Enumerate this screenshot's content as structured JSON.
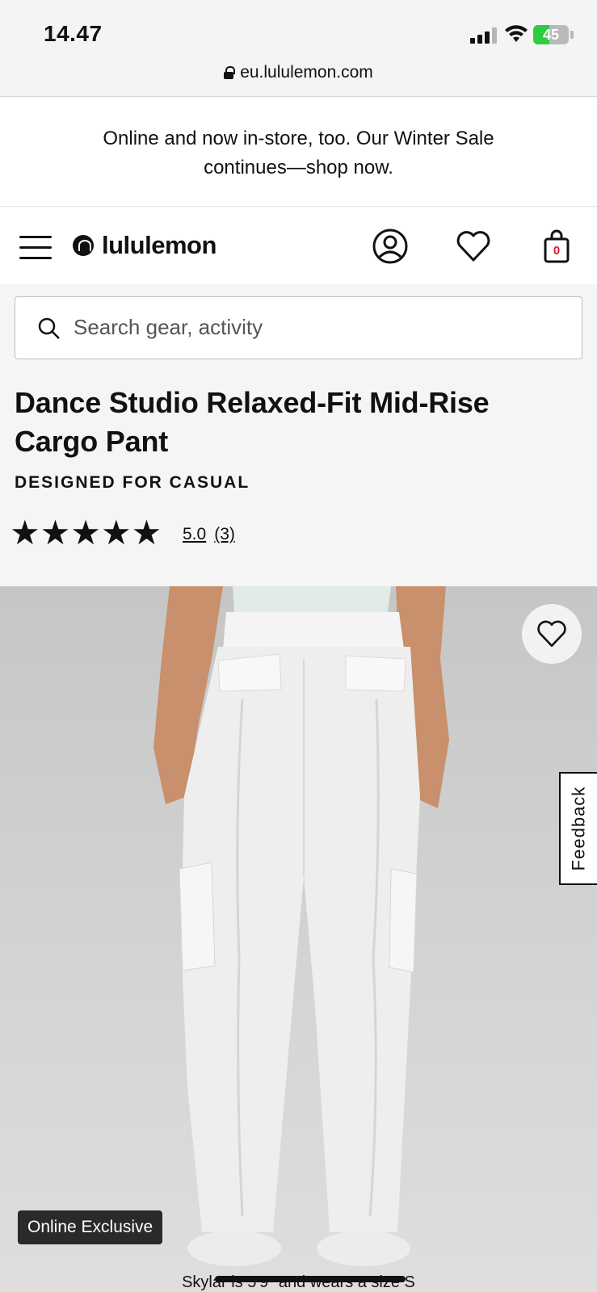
{
  "status_bar": {
    "time": "14.47",
    "battery": "45",
    "battery_fraction": 0.45
  },
  "browser": {
    "url": "eu.lululemon.com"
  },
  "promo": {
    "line1": "Online and now in-store, too. Our Winter Sale",
    "line2": "continues—shop now."
  },
  "header": {
    "logo_text": "lululemon",
    "icons": [
      "menu-icon",
      "account-icon",
      "heart-icon",
      "bag-icon"
    ],
    "cart_count": "0",
    "cart_count_color": "#d22030"
  },
  "search": {
    "placeholder": "Search gear, activity"
  },
  "product": {
    "title": "Dance Studio Relaxed-Fit Mid-Rise Cargo Pant",
    "subtitle": "DESIGNED FOR CASUAL",
    "rating_stars": "★★★★★",
    "rating_value": "5.0",
    "review_count": "(3)",
    "badge": "Online Exclusive",
    "image_caption": "Skylar is 5'9\" and wears a size S",
    "feedback_label": "Feedback"
  },
  "colors": {
    "accent": "#111111",
    "badge_bg": "#2a2a2a",
    "battery_green": "#2ecc40"
  }
}
